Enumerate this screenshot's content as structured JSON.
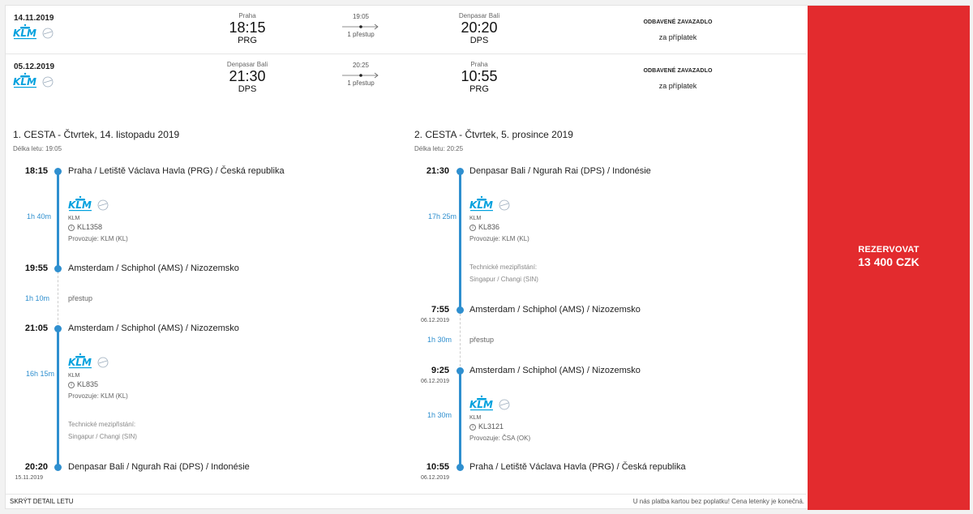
{
  "summary": [
    {
      "date": "14.11.2019",
      "airline": "KLM",
      "dep_city": "Praha",
      "dep_time": "18:15",
      "dep_code": "PRG",
      "duration": "19:05",
      "stops": "1 přestup",
      "arr_city": "Denpasar Bali",
      "arr_time": "20:20",
      "arr_code": "DPS",
      "baggage_title": "ODBAVENÉ ZAVAZADLO",
      "baggage_note": "za příplatek"
    },
    {
      "date": "05.12.2019",
      "airline": "KLM",
      "dep_city": "Denpasar Bali",
      "dep_time": "21:30",
      "dep_code": "DPS",
      "duration": "20:25",
      "stops": "1 přestup",
      "arr_city": "Praha",
      "arr_time": "10:55",
      "arr_code": "PRG",
      "baggage_title": "ODBAVENÉ ZAVAZADLO",
      "baggage_note": "za příplatek"
    }
  ],
  "legs": [
    {
      "title": "1. CESTA - Čtvrtek, 14. listopadu 2019",
      "length": "Délka letu: 19:05",
      "stations": [
        {
          "time": "18:15",
          "name": "Praha / Letiště Václava Havla (PRG) / Česká republika",
          "date": ""
        },
        {
          "time": "19:55",
          "name": "Amsterdam / Schiphol (AMS) / Nizozemsko",
          "date": ""
        },
        {
          "time": "21:05",
          "name": "Amsterdam / Schiphol (AMS) / Nizozemsko",
          "date": ""
        },
        {
          "time": "20:20",
          "name": "Denpasar Bali / Ngurah Rai (DPS) / Indonésie",
          "date": "15.11.2019"
        }
      ],
      "flights": [
        {
          "duration": "1h 40m",
          "carrier": "KLM",
          "number": "KL1358",
          "operated": "Provozuje: KLM (KL)",
          "tech_label": "",
          "tech_value": ""
        },
        {
          "duration": "16h 15m",
          "carrier": "KLM",
          "number": "KL835",
          "operated": "Provozuje: KLM (KL)",
          "tech_label": "Technické mezipřistání:",
          "tech_value": "Singapur / Changi (SIN)"
        }
      ],
      "layover": {
        "duration": "1h 10m",
        "label": "přestup"
      }
    },
    {
      "title": "2. CESTA - Čtvrtek, 5. prosince 2019",
      "length": "Délka letu: 20:25",
      "stations": [
        {
          "time": "21:30",
          "name": "Denpasar Bali / Ngurah Rai (DPS) / Indonésie",
          "date": ""
        },
        {
          "time": "7:55",
          "name": "Amsterdam / Schiphol (AMS) / Nizozemsko",
          "date": "06.12.2019"
        },
        {
          "time": "9:25",
          "name": "Amsterdam / Schiphol (AMS) / Nizozemsko",
          "date": "06.12.2019"
        },
        {
          "time": "10:55",
          "name": "Praha / Letiště Václava Havla (PRG) / Česká republika",
          "date": "06.12.2019"
        }
      ],
      "flights": [
        {
          "duration": "17h 25m",
          "carrier": "KLM",
          "number": "KL836",
          "operated": "Provozuje: KLM (KL)",
          "tech_label": "Technické mezipřistání:",
          "tech_value": "Singapur / Changi (SIN)"
        },
        {
          "duration": "1h 30m",
          "carrier": "KLM",
          "number": "KL3121",
          "operated": "Provozuje: ČSA (OK)",
          "tech_label": "",
          "tech_value": ""
        }
      ],
      "layover": {
        "duration": "1h 30m",
        "label": "přestup"
      }
    }
  ],
  "book": {
    "label": "REZERVOVAT",
    "price": "13 400 CZK"
  },
  "footer": {
    "hide_label": "SKRÝT DETAIL LETU",
    "note": "U nás platba kartou bez poplatku! Cena letenky je konečná."
  },
  "colors": {
    "accent": "#2f8fcf",
    "book_button": "#e32b2e",
    "klm_blue": "#00a1de"
  },
  "icons": {
    "airline_logo": "klm-logo",
    "info": "info-icon",
    "arrow": "arrow-right-icon"
  }
}
